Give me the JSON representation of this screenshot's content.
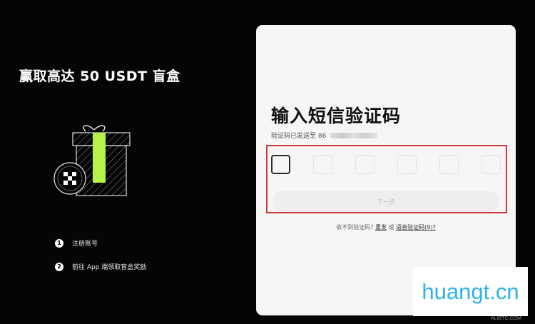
{
  "left": {
    "title": "赢取高达 50 USDT 盲盒",
    "steps": [
      {
        "num": "1",
        "label": "注册账号"
      },
      {
        "num": "2",
        "label": "前往 App 端领取盲盒奖励"
      }
    ]
  },
  "card": {
    "title": "输入短信验证码",
    "subtitle": "验证码已发送至 86",
    "code_boxes": 6,
    "next_button": "下一步",
    "help": {
      "prefix": "收不到验证码?",
      "resend": "重发",
      "or": "或",
      "voice": "语音验证码(9)?"
    }
  },
  "watermark": {
    "text": "huangt.cn",
    "small": "ALIBTC.COM"
  },
  "colors": {
    "background": "#050505",
    "card": "#f7f6f5",
    "highlight": "#c8383a",
    "accent_green": "#b6f24a",
    "watermark_blue": "#2bb3ea"
  }
}
